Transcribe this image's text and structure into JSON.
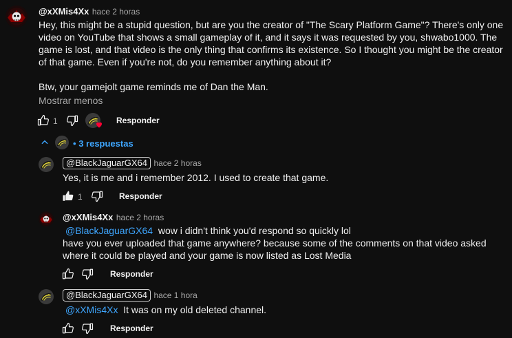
{
  "comment": {
    "author": "@xXMis4Xx",
    "time": "hace 2 horas",
    "text_p1": "Hey, this might be a stupid question, but are you the creator of \"The Scary Platform Game\"? There's only one video on YouTube that shows a small gameplay of it, and it says it was requested by you, shwabo1000. The game is lost, and that video is the only thing that confirms its existence. So I thought you might be the creator of that game. Even if you're not, do you remember anything about it?",
    "text_p2": "Btw, your gamejolt game reminds me of Dan the Man.",
    "show_less": "Mostrar menos",
    "likes": "1",
    "reply_label": "Responder"
  },
  "replies_toggle": {
    "label": "3 respuestas",
    "bullet": "•"
  },
  "replies": [
    {
      "author": "@BlackJaguarGX64",
      "time": "hace 2 horas",
      "text": "Yes, it is me and i remember 2012. I used to create that game.",
      "likes": "1",
      "reply_label": "Responder"
    },
    {
      "author": "@xXMis4Xx",
      "time": "hace 2 horas",
      "mention": "@BlackJaguarGX64",
      "text_l1": "wow i didn't think you'd respond so quickly lol",
      "text_l2": "have you ever uploaded that game anywhere? because some of the comments on that video asked where it could be played and your game is now listed as Lost Media",
      "reply_label": "Responder"
    },
    {
      "author": "@BlackJaguarGX64",
      "time": "hace 1 hora",
      "mention": "@xXMis4Xx",
      "text": "It was on my old deleted channel.",
      "reply_label": "Responder"
    }
  ],
  "colors": {
    "background": "#0f0f0f",
    "link": "#3ea6ff",
    "muted": "#aaaaaa",
    "heart": "#ff0033"
  }
}
